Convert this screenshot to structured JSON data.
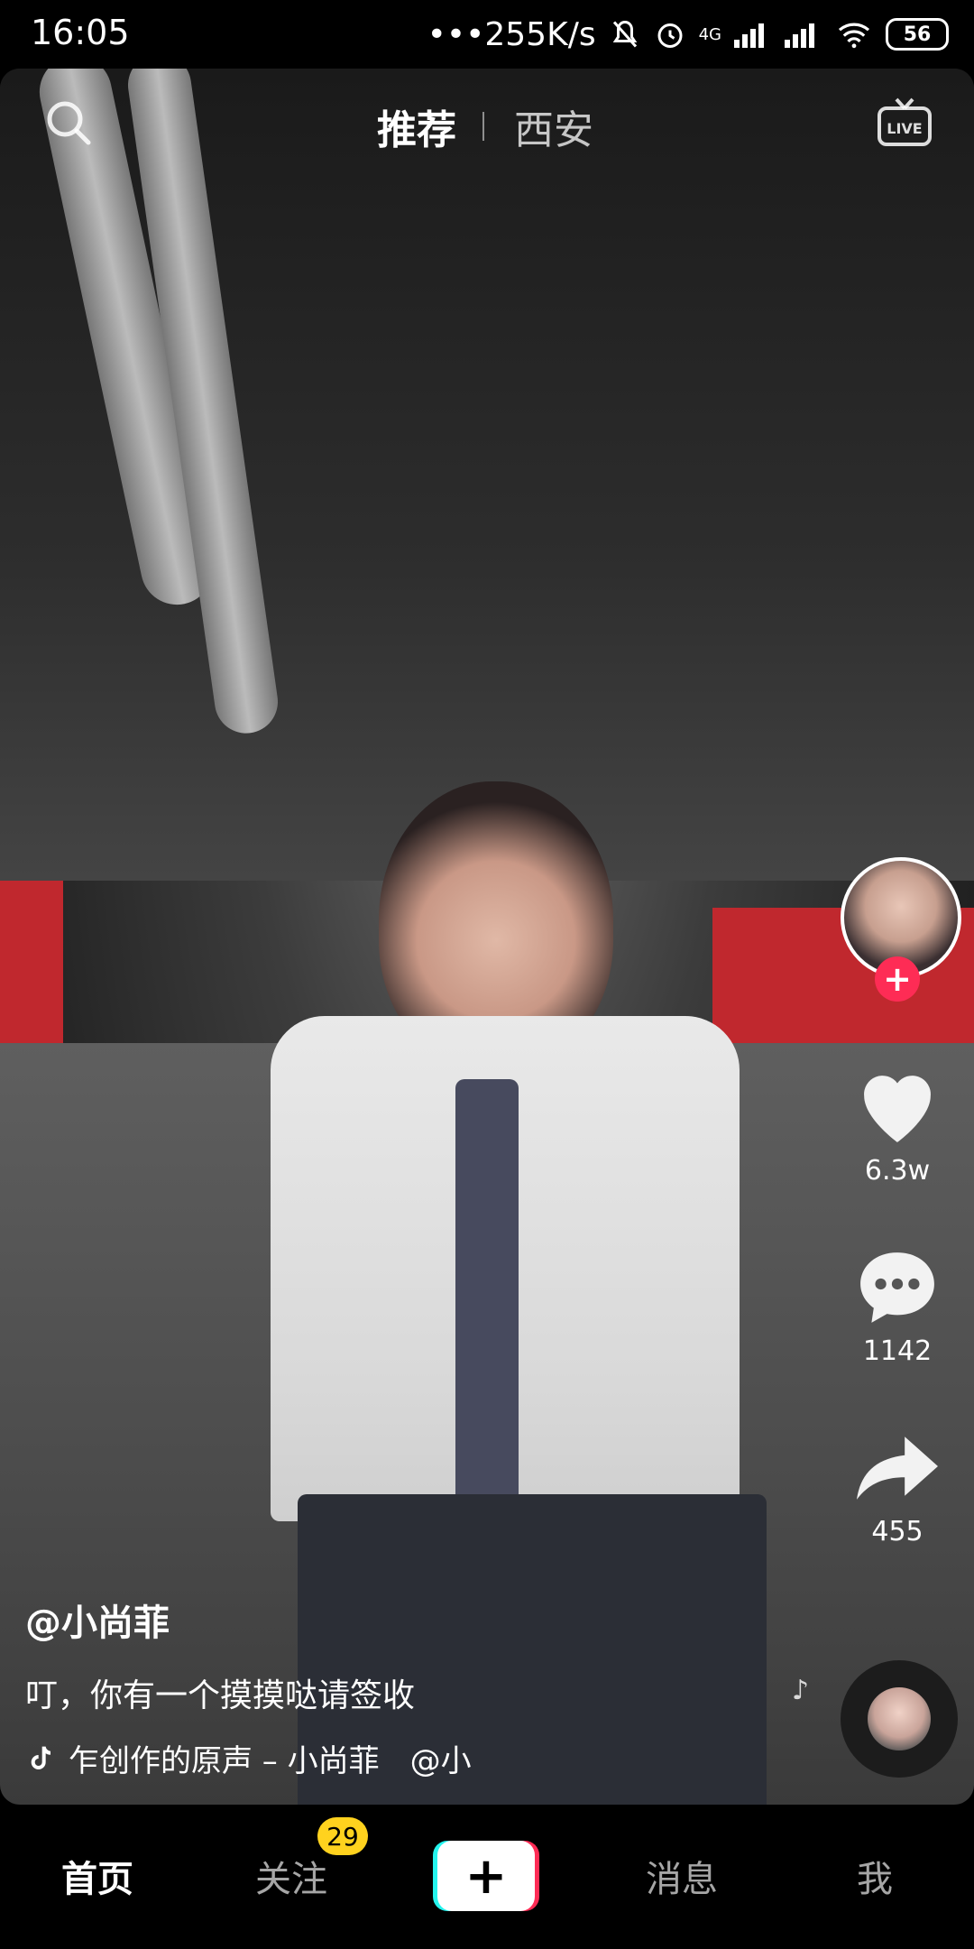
{
  "status_bar": {
    "time": "16:05",
    "network_speed": "•••255K/s",
    "signal_label": "4G",
    "battery": "56"
  },
  "top_tabs": {
    "recommend": "推荐",
    "city": "西安",
    "live": "LIVE"
  },
  "actions": {
    "likes": "6.3w",
    "comments": "1142",
    "shares": "455",
    "follow_plus": "+"
  },
  "caption": {
    "author": "@小尚菲",
    "description": "叮，你有一个摸摸哒请签收",
    "music": "乍创作的原声 – 小尚菲　@小"
  },
  "bottom_nav": {
    "home": "首页",
    "follow": "关注",
    "follow_badge": "29",
    "create": "+",
    "messages": "消息",
    "me": "我"
  },
  "colors": {
    "accent": "#fe2c55",
    "cyan": "#25f4ee",
    "badge": "#ffd21e"
  }
}
